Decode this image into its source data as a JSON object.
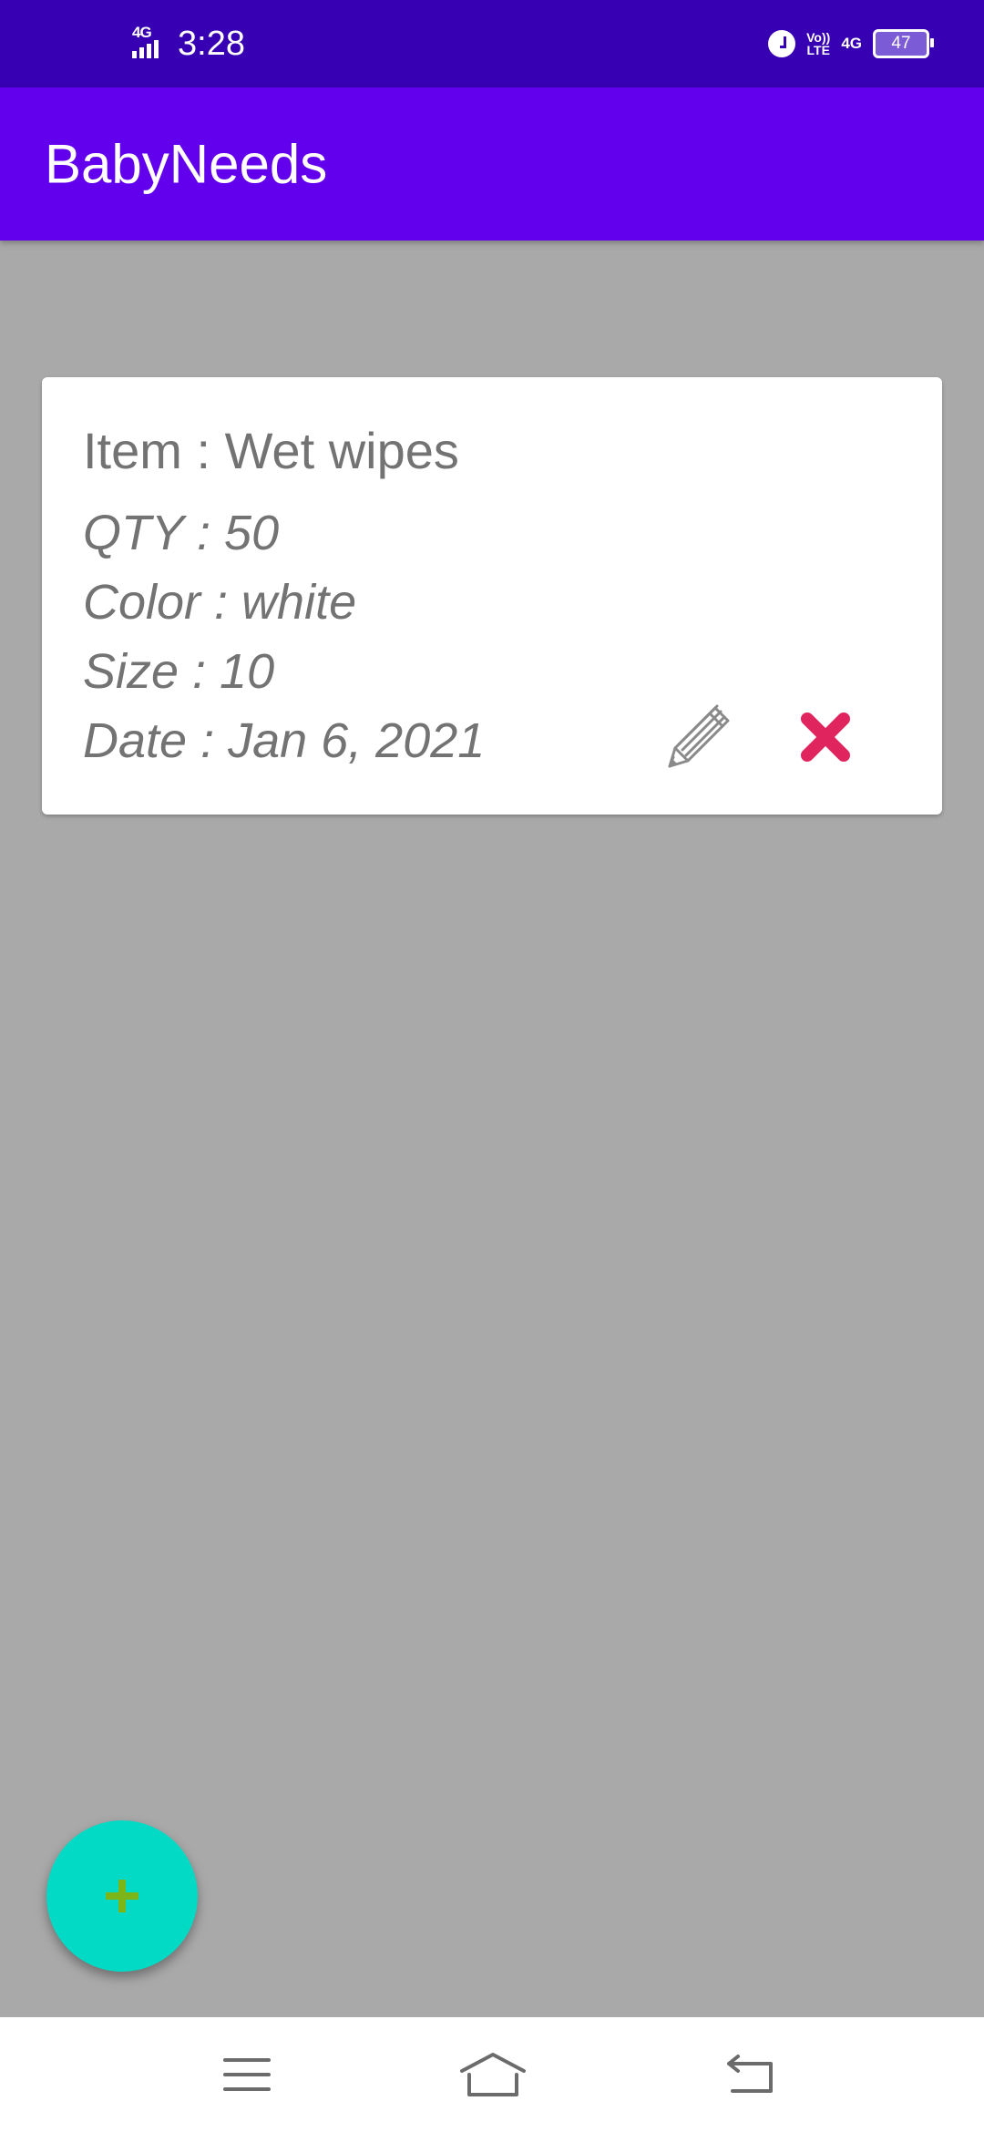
{
  "status_bar": {
    "network_left": "4G",
    "time": "3:28",
    "volte_line1": "Vo))",
    "volte_line2": "LTE",
    "network_right": "4G",
    "battery": "47",
    "icons": [
      "signal-icon",
      "alarm-icon",
      "volte-icon",
      "battery-icon"
    ]
  },
  "app_bar": {
    "title": "BabyNeeds"
  },
  "items": [
    {
      "item": "Item : Wet wipes",
      "qty": "QTY : 50",
      "color": "Color : white",
      "size": "Size : 10",
      "date": "Date : Jan 6, 2021",
      "actions": [
        "pencil-icon",
        "close-icon"
      ]
    }
  ],
  "fab": {
    "icon": "plus-icon"
  },
  "nav_bar": {
    "icons": [
      "menu-icon",
      "home-icon",
      "back-icon"
    ]
  },
  "colors": {
    "status_bar": "#3700b3",
    "app_bar": "#6200ee",
    "background": "#a9a9a9",
    "card": "#ffffff",
    "text": "#737373",
    "delete": "#e0245e",
    "fab": "#03dac5",
    "fab_icon": "#7cb518"
  }
}
